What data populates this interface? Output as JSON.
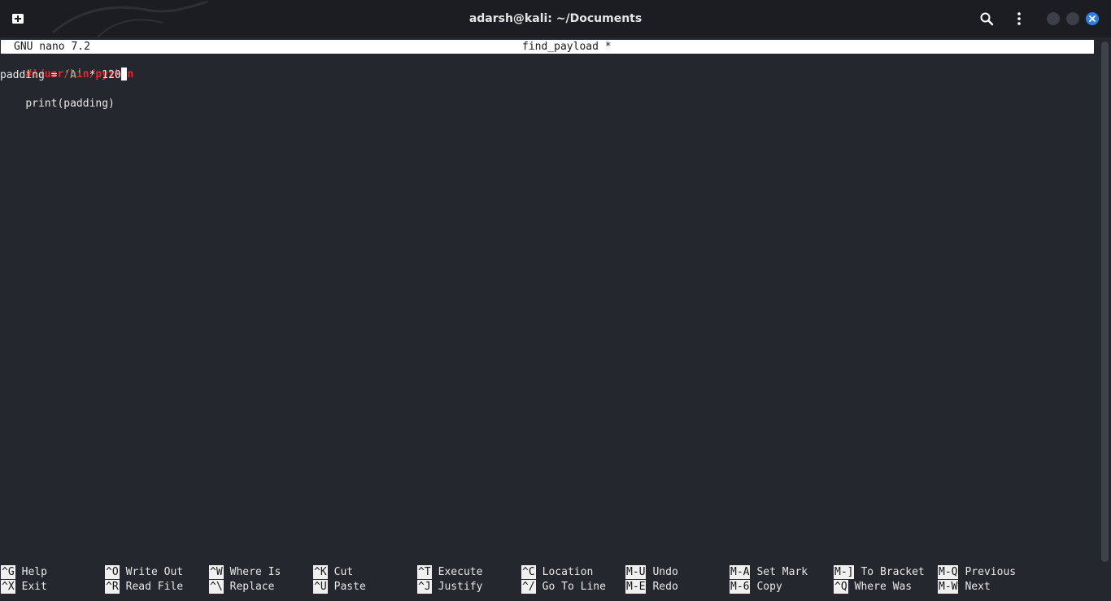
{
  "window": {
    "title": "adarsh@kali: ~/Documents"
  },
  "icons": {
    "new_tab": "new-tab-icon",
    "search": "search-icon",
    "menu": "kebab-menu-icon",
    "minimize": "minimize-icon",
    "maximize": "maximize-icon",
    "close": "close-icon"
  },
  "nano": {
    "version_label": "GNU nano 7.2",
    "filename": "find_payload *",
    "lines": {
      "shebang": "#!/usr/bin/python",
      "l2_prefix": "padding = ",
      "l2_string": "'A'",
      "l2_suffix": " * 120",
      "l3": "print(padding)"
    },
    "shortcuts_row1": [
      {
        "key": "^G",
        "label": "Help"
      },
      {
        "key": "^O",
        "label": "Write Out"
      },
      {
        "key": "^W",
        "label": "Where Is"
      },
      {
        "key": "^K",
        "label": "Cut"
      },
      {
        "key": "^T",
        "label": "Execute"
      },
      {
        "key": "^C",
        "label": "Location"
      },
      {
        "key": "M-U",
        "label": "Undo"
      },
      {
        "key": "M-A",
        "label": "Set Mark"
      },
      {
        "key": "M-]",
        "label": "To Bracket"
      },
      {
        "key": "M-Q",
        "label": "Previous"
      }
    ],
    "shortcuts_row2": [
      {
        "key": "^X",
        "label": "Exit"
      },
      {
        "key": "^R",
        "label": "Read File"
      },
      {
        "key": "^\\",
        "label": "Replace"
      },
      {
        "key": "^U",
        "label": "Paste"
      },
      {
        "key": "^J",
        "label": "Justify"
      },
      {
        "key": "^/",
        "label": "Go To Line"
      },
      {
        "key": "M-E",
        "label": "Redo"
      },
      {
        "key": "M-6",
        "label": "Copy"
      },
      {
        "key": "^Q",
        "label": "Where Was"
      },
      {
        "key": "M-W",
        "label": "Next"
      }
    ]
  },
  "colors": {
    "shebang": "#e8262e",
    "string_literal": "#3fd3c1",
    "close_button": "#2f7fe0"
  }
}
